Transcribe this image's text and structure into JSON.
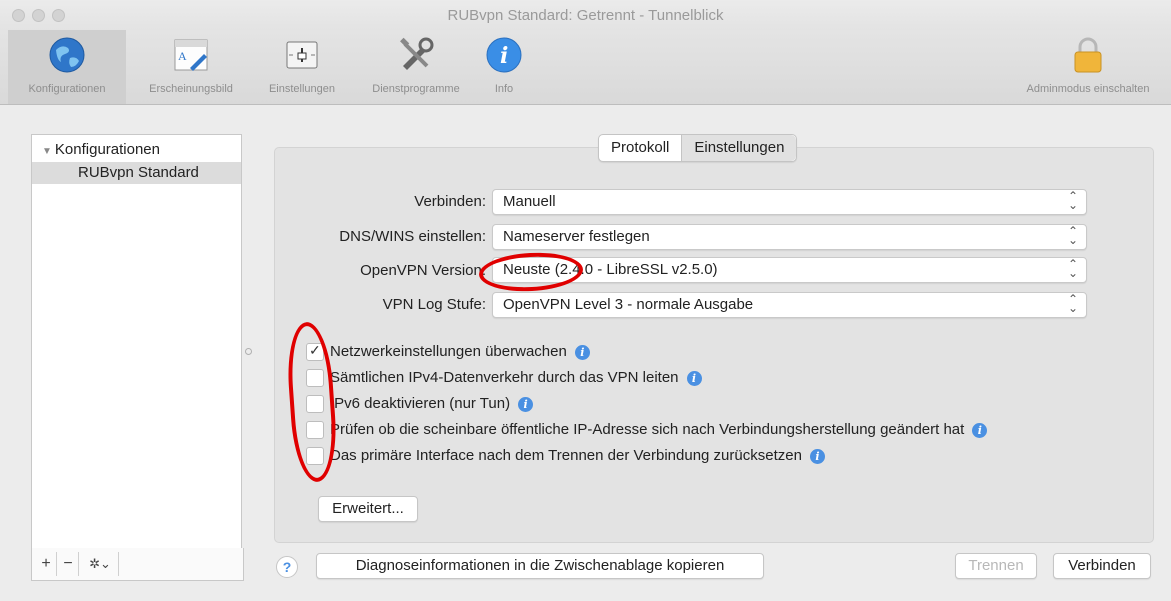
{
  "window": {
    "title": "RUBvpn Standard: Getrennt - Tunnelblick"
  },
  "toolbar": {
    "items": [
      {
        "label": "Konfigurationen",
        "icon": "globe-icon"
      },
      {
        "label": "Erscheinungsbild",
        "icon": "appearance-icon"
      },
      {
        "label": "Einstellungen",
        "icon": "settings-switch-icon"
      },
      {
        "label": "Dienstprogramme",
        "icon": "tools-icon"
      },
      {
        "label": "Info",
        "icon": "info-icon"
      }
    ],
    "admin_label": "Adminmodus einschalten"
  },
  "sidebar": {
    "header": "Konfigurationen",
    "items": [
      {
        "label": "RUBvpn Standard"
      }
    ],
    "buttons": {
      "add": "+",
      "remove": "−",
      "gear": "✲⌄"
    }
  },
  "tabs": {
    "protocol": "Protokoll",
    "settings": "Einstellungen",
    "selected": "Einstellungen"
  },
  "form": {
    "connect": {
      "label": "Verbinden:",
      "value": "Manuell"
    },
    "dns": {
      "label": "DNS/WINS einstellen:",
      "value": "Nameserver festlegen"
    },
    "openvpn": {
      "label": "OpenVPN Version:",
      "value": "Neuste (2.4.0 - LibreSSL v2.5.0)"
    },
    "loglevel": {
      "label": "VPN Log Stufe:",
      "value": "OpenVPN Level 3 - normale Ausgabe"
    }
  },
  "checkboxes": [
    {
      "label": "Netzwerkeinstellungen überwachen",
      "checked": true
    },
    {
      "label": "Sämtlichen IPv4-Datenverkehr durch das VPN leiten",
      "checked": false
    },
    {
      "label": "IPv6 deaktivieren (nur Tun)",
      "checked": false
    },
    {
      "label": "Prüfen ob die scheinbare öffentliche IP-Adresse sich nach Verbindungsherstellung geändert hat",
      "checked": false
    },
    {
      "label": "Das primäre Interface nach dem Trennen der Verbindung zurücksetzen",
      "checked": false
    }
  ],
  "buttons": {
    "advanced": "Erweitert...",
    "help": "?",
    "diagnostics": "Diagnoseinformationen in die Zwischenablage kopieren",
    "disconnect": "Trennen",
    "connect": "Verbinden"
  },
  "colors": {
    "accent": "#4a90e2",
    "annotation": "#e00000"
  }
}
